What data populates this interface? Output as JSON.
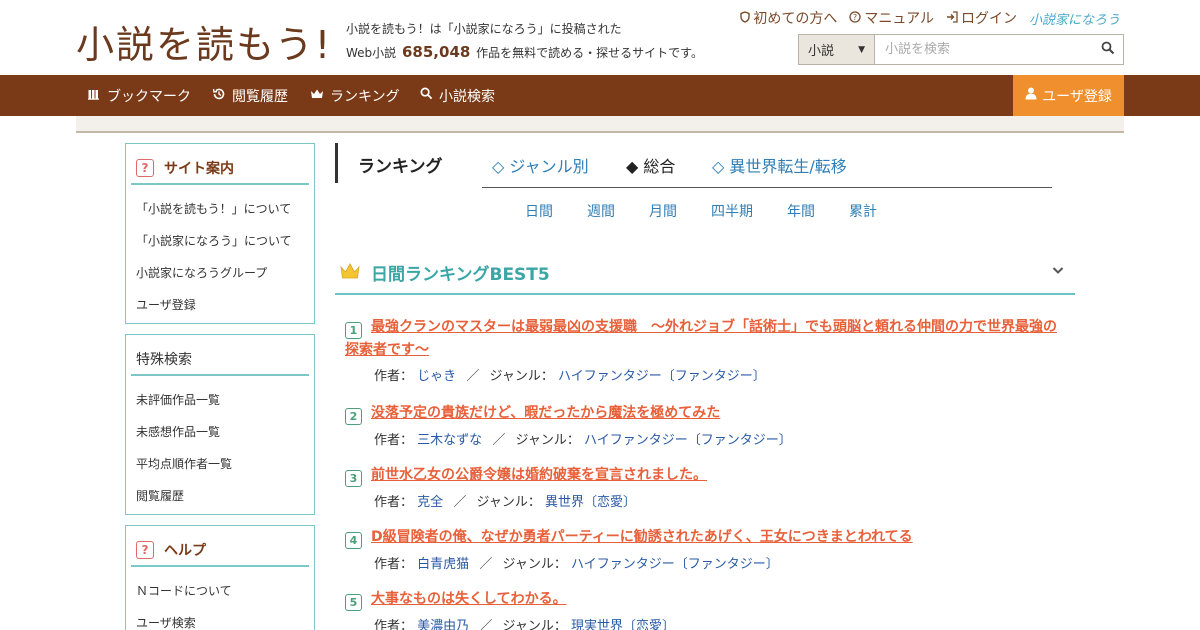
{
  "header": {
    "logo": "小説を読もう!",
    "desc_line1": "小説を読もう！は「小説家になろう」に投稿された",
    "desc_prefix": "Web小説",
    "work_count": "685,048",
    "desc_suffix": "作品を無料で読める・探せるサイトです。",
    "links": [
      "初めての方へ",
      "マニュアル",
      "ログイン"
    ],
    "naro_logo": "小説家になろう"
  },
  "search": {
    "select_value": "小説",
    "placeholder": "小説を検索"
  },
  "nav": {
    "items": [
      "ブックマーク",
      "閲覧履歴",
      "ランキング",
      "小説検索"
    ],
    "register": "ユーザ登録"
  },
  "sidebar": {
    "site_guide": {
      "title": "サイト案内",
      "items": [
        "「小説を読もう！」について",
        "「小説家になろう」について",
        "小説家になろうグループ",
        "ユーザ登録"
      ]
    },
    "special_search": {
      "title": "特殊検索",
      "items": [
        "未評価作品一覧",
        "未感想作品一覧",
        "平均点順作者一覧",
        "閲覧履歴"
      ]
    },
    "help": {
      "title": "ヘルプ",
      "items": [
        "Ｎコードについて",
        "ユーザ検索"
      ]
    }
  },
  "ranking": {
    "title": "ランキング",
    "tabs": [
      "◇ ジャンル別",
      "◆ 総合",
      "◇ 異世界転生/転移"
    ],
    "periods": [
      "日間",
      "週間",
      "月間",
      "四半期",
      "年間",
      "累計"
    ],
    "best_title": "日間ランキングBEST5",
    "author_label": "作者：",
    "genre_label": "ジャンル：",
    "slash": "／",
    "entries": [
      {
        "rank": "1",
        "title": "最強クランのマスターは最弱最凶の支援職　～外れジョブ「話術士」でも頭脳と頼れる仲間の力で世界最強の探索者です～",
        "author": "じゃき",
        "genre": "ハイファンタジー〔ファンタジー〕"
      },
      {
        "rank": "2",
        "title": "没落予定の貴族だけど、暇だったから魔法を極めてみた",
        "author": "三木なずな",
        "genre": "ハイファンタジー〔ファンタジー〕"
      },
      {
        "rank": "3",
        "title": "前世水乙女の公爵令嬢は婚約破棄を宣言されました。",
        "author": "克全",
        "genre": "異世界〔恋愛〕"
      },
      {
        "rank": "4",
        "title": "D級冒険者の俺、なぜか勇者パーティーに勧誘されたあげく、王女につきまとわれてる",
        "author": "白青虎猫",
        "genre": "ハイファンタジー〔ファンタジー〕"
      },
      {
        "rank": "5",
        "title": "大事なものは失くしてわかる。",
        "author": "美濃由乃",
        "genre": "現実世界〔恋愛〕"
      }
    ]
  },
  "colors": {
    "brand_brown": "#7b3a17",
    "accent_orange": "#f08f2e",
    "teal": "#3aa6a6",
    "title_orange": "#e8603a",
    "link_blue": "#2f7fb6"
  }
}
